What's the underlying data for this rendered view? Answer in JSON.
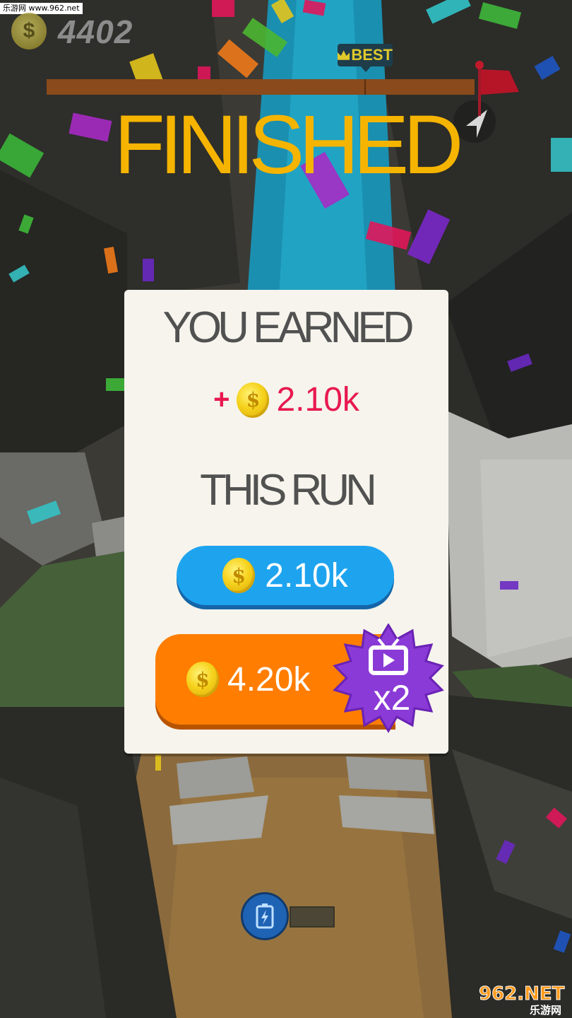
{
  "watermark_top": "乐游网 www.962.net",
  "coin_total": "4402",
  "best_label": "BEST",
  "finished_title": "FINISHED",
  "card": {
    "heading": "YOU EARNED",
    "earned_prefix": "+",
    "earned_value": "2.10k",
    "subheading": "THIS RUN",
    "collect_value": "2.10k",
    "double_value": "4.20k",
    "double_multiplier": "x2"
  },
  "colors": {
    "finished": "#f5b400",
    "earned": "#e8184f",
    "blue_button": "#1ea4ef",
    "orange_button": "#ff7d00",
    "badge": "#8a3ad6"
  },
  "icons": [
    "coin-icon",
    "crown-icon",
    "flag-icon",
    "tv-ad-icon",
    "battery-powerup-icon"
  ],
  "watermark_bottom": {
    "brand": "962.NET",
    "sub": "乐游网"
  }
}
